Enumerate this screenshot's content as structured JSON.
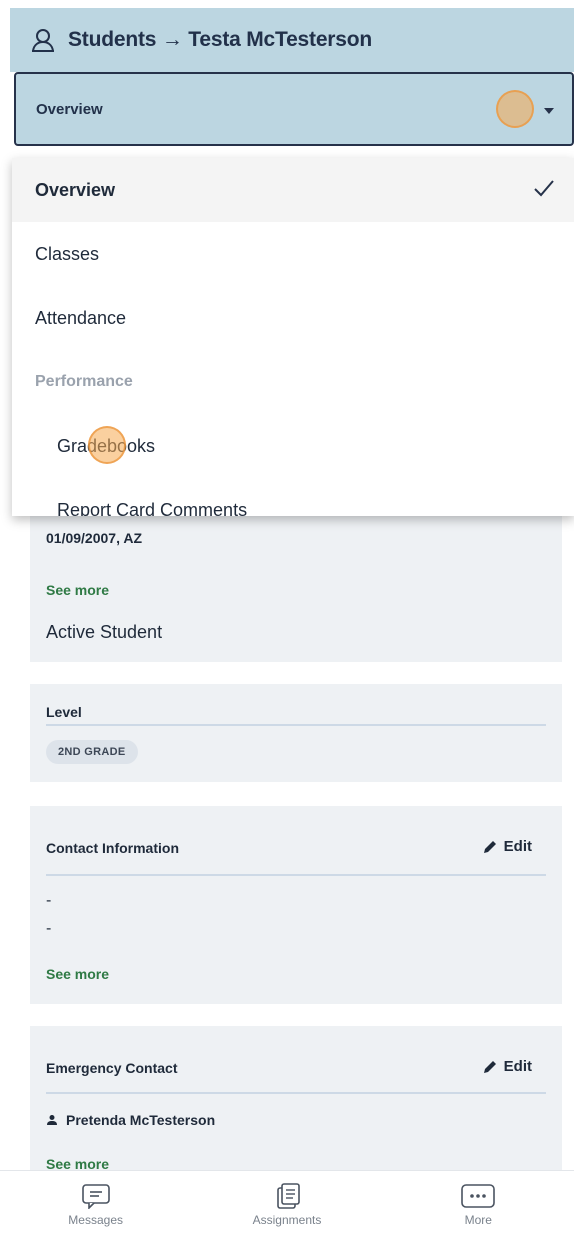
{
  "header": {
    "title": "Students → Testa McTesterson"
  },
  "view_select": {
    "selected": "Overview"
  },
  "dropdown": {
    "items": [
      {
        "label": "Overview"
      },
      {
        "label": "Classes"
      },
      {
        "label": "Attendance"
      },
      {
        "label": "Performance"
      },
      {
        "label": "Gradebooks"
      },
      {
        "label": "Report Card Comments"
      }
    ]
  },
  "info_card": {
    "dob_location": "01/09/2007, AZ",
    "see_more": "See more",
    "status": "Active Student"
  },
  "level_card": {
    "label": "Level",
    "badge": "2ND GRADE"
  },
  "contact_card": {
    "title": "Contact Information",
    "edit": "Edit",
    "line1": "-",
    "line2": "-",
    "see_more": "See more"
  },
  "emergency_card": {
    "title": "Emergency Contact",
    "edit": "Edit",
    "contact_name": "Pretenda McTesterson",
    "see_more": "See more"
  },
  "tabbar": {
    "messages": "Messages",
    "assignments": "Assignments",
    "more": "More"
  },
  "colors": {
    "header_bg": "#bcd6e1",
    "accent_green": "#2f7a45",
    "card_bg": "#eef1f4"
  }
}
